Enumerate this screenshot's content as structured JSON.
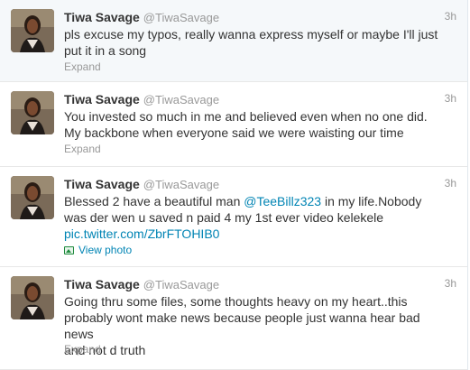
{
  "tweets": [
    {
      "name": "Tiwa Savage",
      "handle": "@TiwaSavage",
      "time": "3h",
      "text_line1": "pls excuse my typos, really wanna express myself or maybe I'll just",
      "text_line2": "put it in a song",
      "expand_label": "Expand"
    },
    {
      "name": "Tiwa Savage",
      "handle": "@TiwaSavage",
      "time": "3h",
      "text_line1": "You invested so much in me and believed even when no one did.",
      "text_line2": "My backbone when everyone said we were waisting our time",
      "expand_label": "Expand"
    },
    {
      "name": "Tiwa Savage",
      "handle": "@TiwaSavage",
      "time": "3h",
      "text_pre": "Blessed 2 have a beautiful man ",
      "mention": "@TeeBillz323",
      "text_post": " in my life.Nobody",
      "text_line2": "was der wen u saved n paid 4 my 1st ever video kelekele",
      "link": "pic.twitter.com/ZbrFTOHIB0",
      "view_photo_label": "View photo"
    },
    {
      "name": "Tiwa Savage",
      "handle": "@TiwaSavage",
      "time": "3h",
      "text_line1": "Going thru some files, some thoughts heavy on my heart..this",
      "text_line2": "probably wont make news because people just wanna hear bad news",
      "text_line3": "and not d truth",
      "expand_label": "Expand"
    }
  ],
  "colors": {
    "link": "#0084b4",
    "muted": "#999999",
    "text": "#333333",
    "divider": "#e8e8e8"
  }
}
